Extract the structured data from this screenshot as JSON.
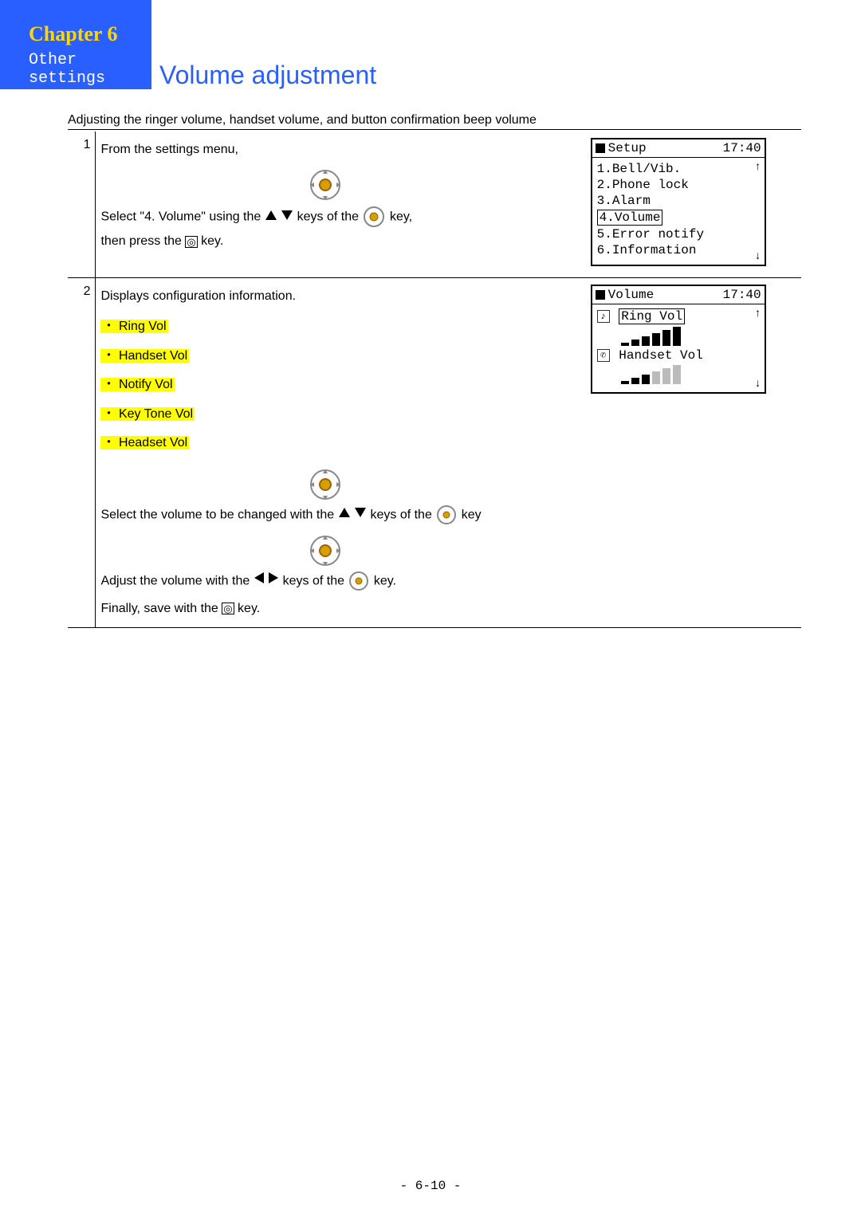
{
  "header": {
    "chapter": "Chapter 6",
    "subtitle": "Other settings",
    "title": "Volume adjustment"
  },
  "intro": "Adjusting the ringer volume, handset volume, and button confirmation beep volume",
  "step1": {
    "num": "1",
    "line1": "From the settings menu,",
    "line2a": "Select \"4. Volume\"  using the ",
    "line2b": " keys of the ",
    "line2c": " key,",
    "line3a": "then press the ",
    "line3b": " key.",
    "screen": {
      "title": "Setup",
      "time": "17:40",
      "items": [
        "1.Bell/Vib.",
        "2.Phone lock",
        "3.Alarm",
        "4.Volume",
        "5.Error notify",
        "6.Information"
      ],
      "selectedIndex": 3
    }
  },
  "step2": {
    "num": "2",
    "line1": "Displays configuration information.",
    "bullets": [
      "Ring Vol",
      "Handset Vol",
      "Notify Vol",
      "Key Tone Vol",
      "Headset Vol"
    ],
    "sel_a": "Select the volume to be changed with the ",
    "sel_b": " keys of the ",
    "sel_c": " key",
    "adj_a": "Adjust the volume with the ",
    "adj_b": " keys of the ",
    "adj_c": " key.",
    "fin_a": "Finally, save with the ",
    "fin_b": "  key.",
    "screen": {
      "title": "Volume",
      "time": "17:40",
      "ring_label": "Ring Vol",
      "handset_label": "Handset Vol"
    }
  },
  "page_number": "- 6-10 -"
}
